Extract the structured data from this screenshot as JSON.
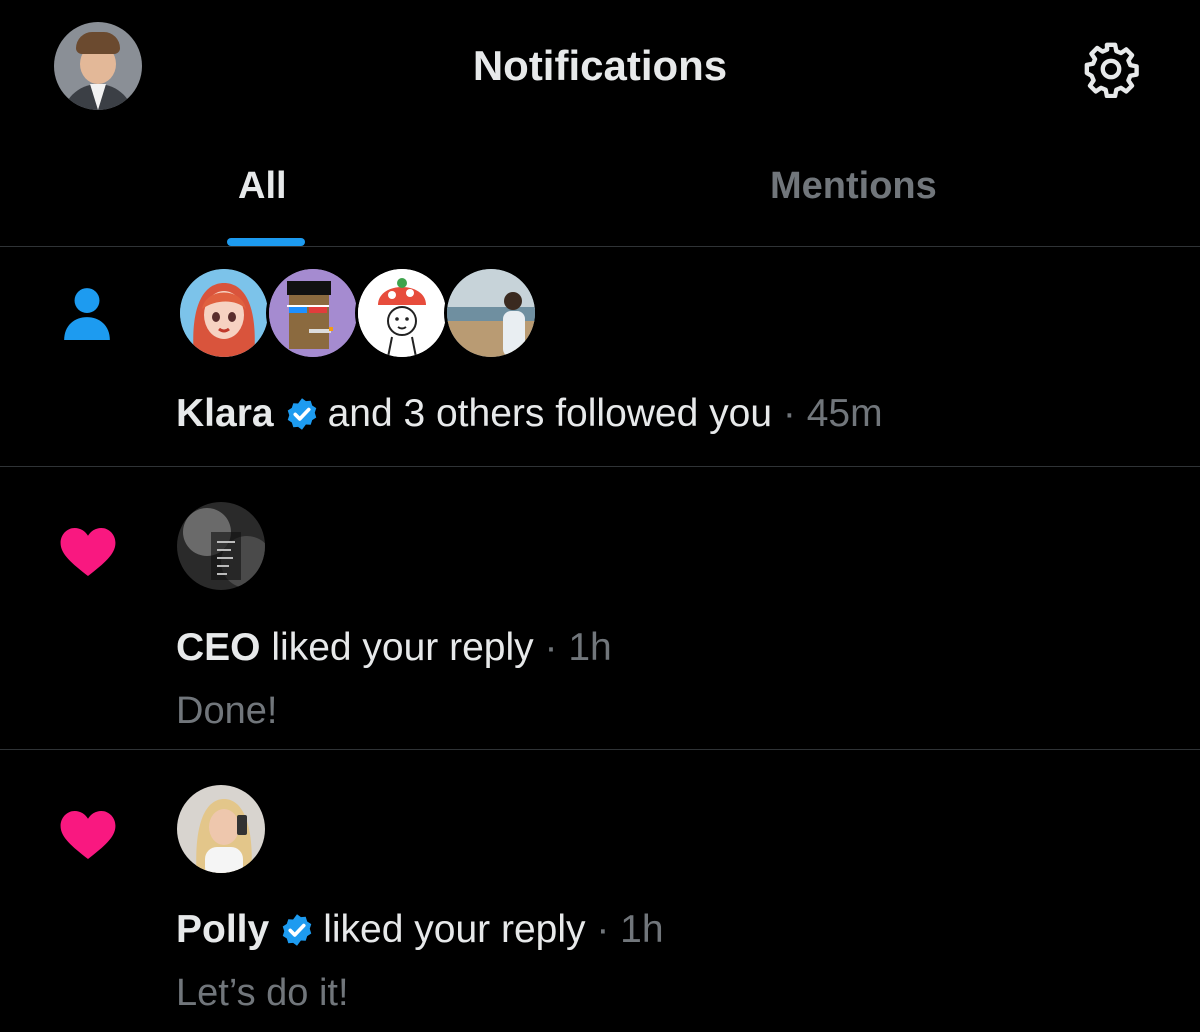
{
  "header": {
    "title": "Notifications",
    "avatar_icon": "user-avatar",
    "settings_icon": "gear-icon"
  },
  "tabs": [
    {
      "label": "All",
      "active": true
    },
    {
      "label": "Mentions",
      "active": false
    }
  ],
  "colors": {
    "accent": "#1d9bf0",
    "like": "#f91880",
    "muted": "#71767b",
    "divider": "#2f3336"
  },
  "notifications": [
    {
      "type": "follow",
      "icon": "person-icon",
      "actor": "Klara",
      "verified": true,
      "text": "and 3 others followed you",
      "separator": "·",
      "time": "45m",
      "avatars": [
        "klara-avatar",
        "pixel-punk-avatar",
        "mushroom-avatar",
        "beach-photo-avatar"
      ]
    },
    {
      "type": "like",
      "icon": "heart-icon",
      "actor": "CEO",
      "verified": false,
      "text": "liked your reply",
      "separator": "·",
      "time": "1h",
      "content": "Done!"
    },
    {
      "type": "like",
      "icon": "heart-icon",
      "actor": "Polly",
      "verified": true,
      "text": "liked your reply",
      "separator": "·",
      "time": "1h",
      "content": "Let’s do it!"
    }
  ]
}
